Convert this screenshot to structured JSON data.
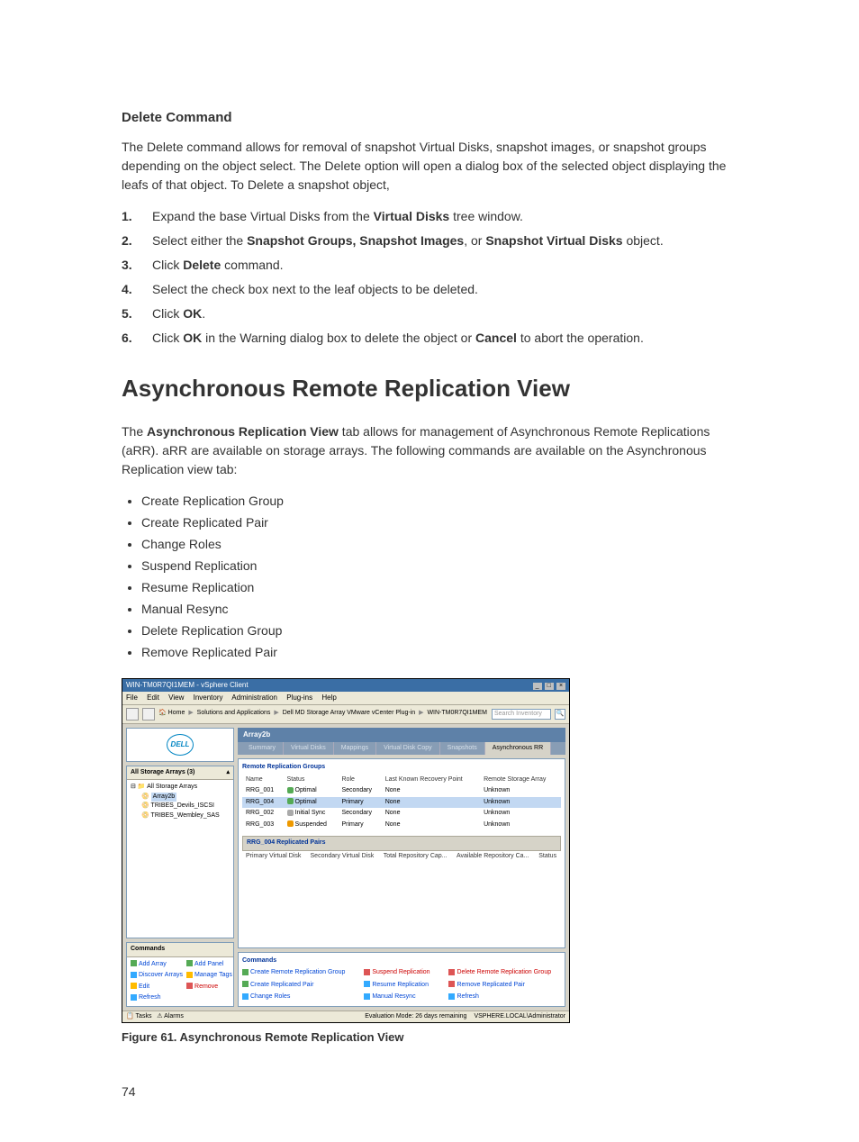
{
  "section1": {
    "heading": "Delete Command",
    "intro": "The Delete command allows for removal of snapshot Virtual Disks, snapshot images, or snapshot groups depending on the object select. The Delete option will open a dialog box of the selected object displaying the leafs of that object. To Delete a snapshot object,",
    "steps": {
      "s1a": "Expand the base Virtual Disks from the ",
      "s1b": "Virtual Disks",
      "s1c": " tree window.",
      "s2a": "Select either the ",
      "s2b": "Snapshot Groups, Snapshot Images",
      "s2c": ", or ",
      "s2d": "Snapshot Virtual Disks",
      "s2e": " object.",
      "s3a": "Click ",
      "s3b": "Delete",
      "s3c": " command.",
      "s4": "Select the check box next to the leaf objects to be deleted.",
      "s5a": "Click ",
      "s5b": "OK",
      "s5c": ".",
      "s6a": "Click ",
      "s6b": "OK",
      "s6c": " in the Warning dialog box to delete the object or ",
      "s6d": "Cancel",
      "s6e": " to abort the operation."
    }
  },
  "section2": {
    "heading": "Asynchronous Remote Replication View",
    "para_a": "The ",
    "para_b": "Asynchronous Replication View",
    "para_c": " tab allows for management of Asynchronous Remote Replications (aRR). aRR are available on storage arrays. The following commands are available on the Asynchronous Replication view tab:",
    "bullets": [
      "Create Replication Group",
      "Create Replicated Pair",
      "Change Roles",
      "Suspend Replication",
      "Resume Replication",
      "Manual Resync",
      "Delete Replication Group",
      "Remove Replicated Pair"
    ]
  },
  "screenshot": {
    "title": "WIN-TM0R7QI1MEM - vSphere Client",
    "menu": [
      "File",
      "Edit",
      "View",
      "Inventory",
      "Administration",
      "Plug-ins",
      "Help"
    ],
    "breadcrumb": {
      "home": "Home",
      "solutions": "Solutions and Applications",
      "plugin": "Dell MD Storage Array VMware vCenter Plug-in",
      "host": "WIN-TM0R7QI1MEM"
    },
    "search_placeholder": "Search Inventory",
    "logo": "DELL",
    "tree": {
      "header": "All Storage Arrays (3)",
      "root": "All Storage Arrays",
      "items": [
        "Array2b",
        "TRIBES_Devils_ISCSI",
        "TRIBES_Wembley_SAS"
      ]
    },
    "left_cmds": {
      "header": "Commands",
      "items": [
        "Add Array",
        "Add Panel",
        "Discover Arrays",
        "Manage Tags",
        "Edit",
        "Remove",
        "Refresh"
      ]
    },
    "content_title": "Array2b",
    "tabs": [
      "Summary",
      "Virtual Disks",
      "Mappings",
      "Virtual Disk Copy",
      "Snapshots",
      "Asynchronous RR"
    ],
    "groups_title": "Remote Replication Groups",
    "groups_cols": [
      "Name",
      "Status",
      "Role",
      "Last Known Recovery Point",
      "Remote Storage Array"
    ],
    "groups_rows": [
      {
        "name": "RRG_001",
        "status": "Optimal",
        "st": "ok",
        "role": "Secondary",
        "lkrp": "None",
        "rsa": "Unknown"
      },
      {
        "name": "RRG_004",
        "status": "Optimal",
        "st": "ok",
        "role": "Primary",
        "lkrp": "None",
        "rsa": "Unknown"
      },
      {
        "name": "RRG_002",
        "status": "Initial Sync",
        "st": "sync",
        "role": "Secondary",
        "lkrp": "None",
        "rsa": "Unknown"
      },
      {
        "name": "RRG_003",
        "status": "Suspended",
        "st": "sus",
        "role": "Primary",
        "lkrp": "None",
        "rsa": "Unknown"
      }
    ],
    "pairs_title": "RRG_004 Replicated Pairs",
    "pairs_cols": [
      "Primary Virtual Disk",
      "Secondary Virtual Disk",
      "Total Repository Cap...",
      "Available Repository Ca...",
      "Status"
    ],
    "lower_cmds_title": "Commands",
    "lower_cmds": [
      "Create Remote Replication Group",
      "Suspend Replication",
      "Delete Remote Replication Group",
      "Create Replicated Pair",
      "Resume Replication",
      "Remove Replicated Pair",
      "Change Roles",
      "Manual Resync",
      "Refresh"
    ],
    "status_left_tasks": "Tasks",
    "status_left_alarms": "Alarms",
    "status_eval": "Evaluation Mode: 26 days remaining",
    "status_user": "VSPHERE.LOCAL\\Administrator"
  },
  "figure_caption": "Figure 61. Asynchronous Remote Replication View",
  "page_number": "74"
}
